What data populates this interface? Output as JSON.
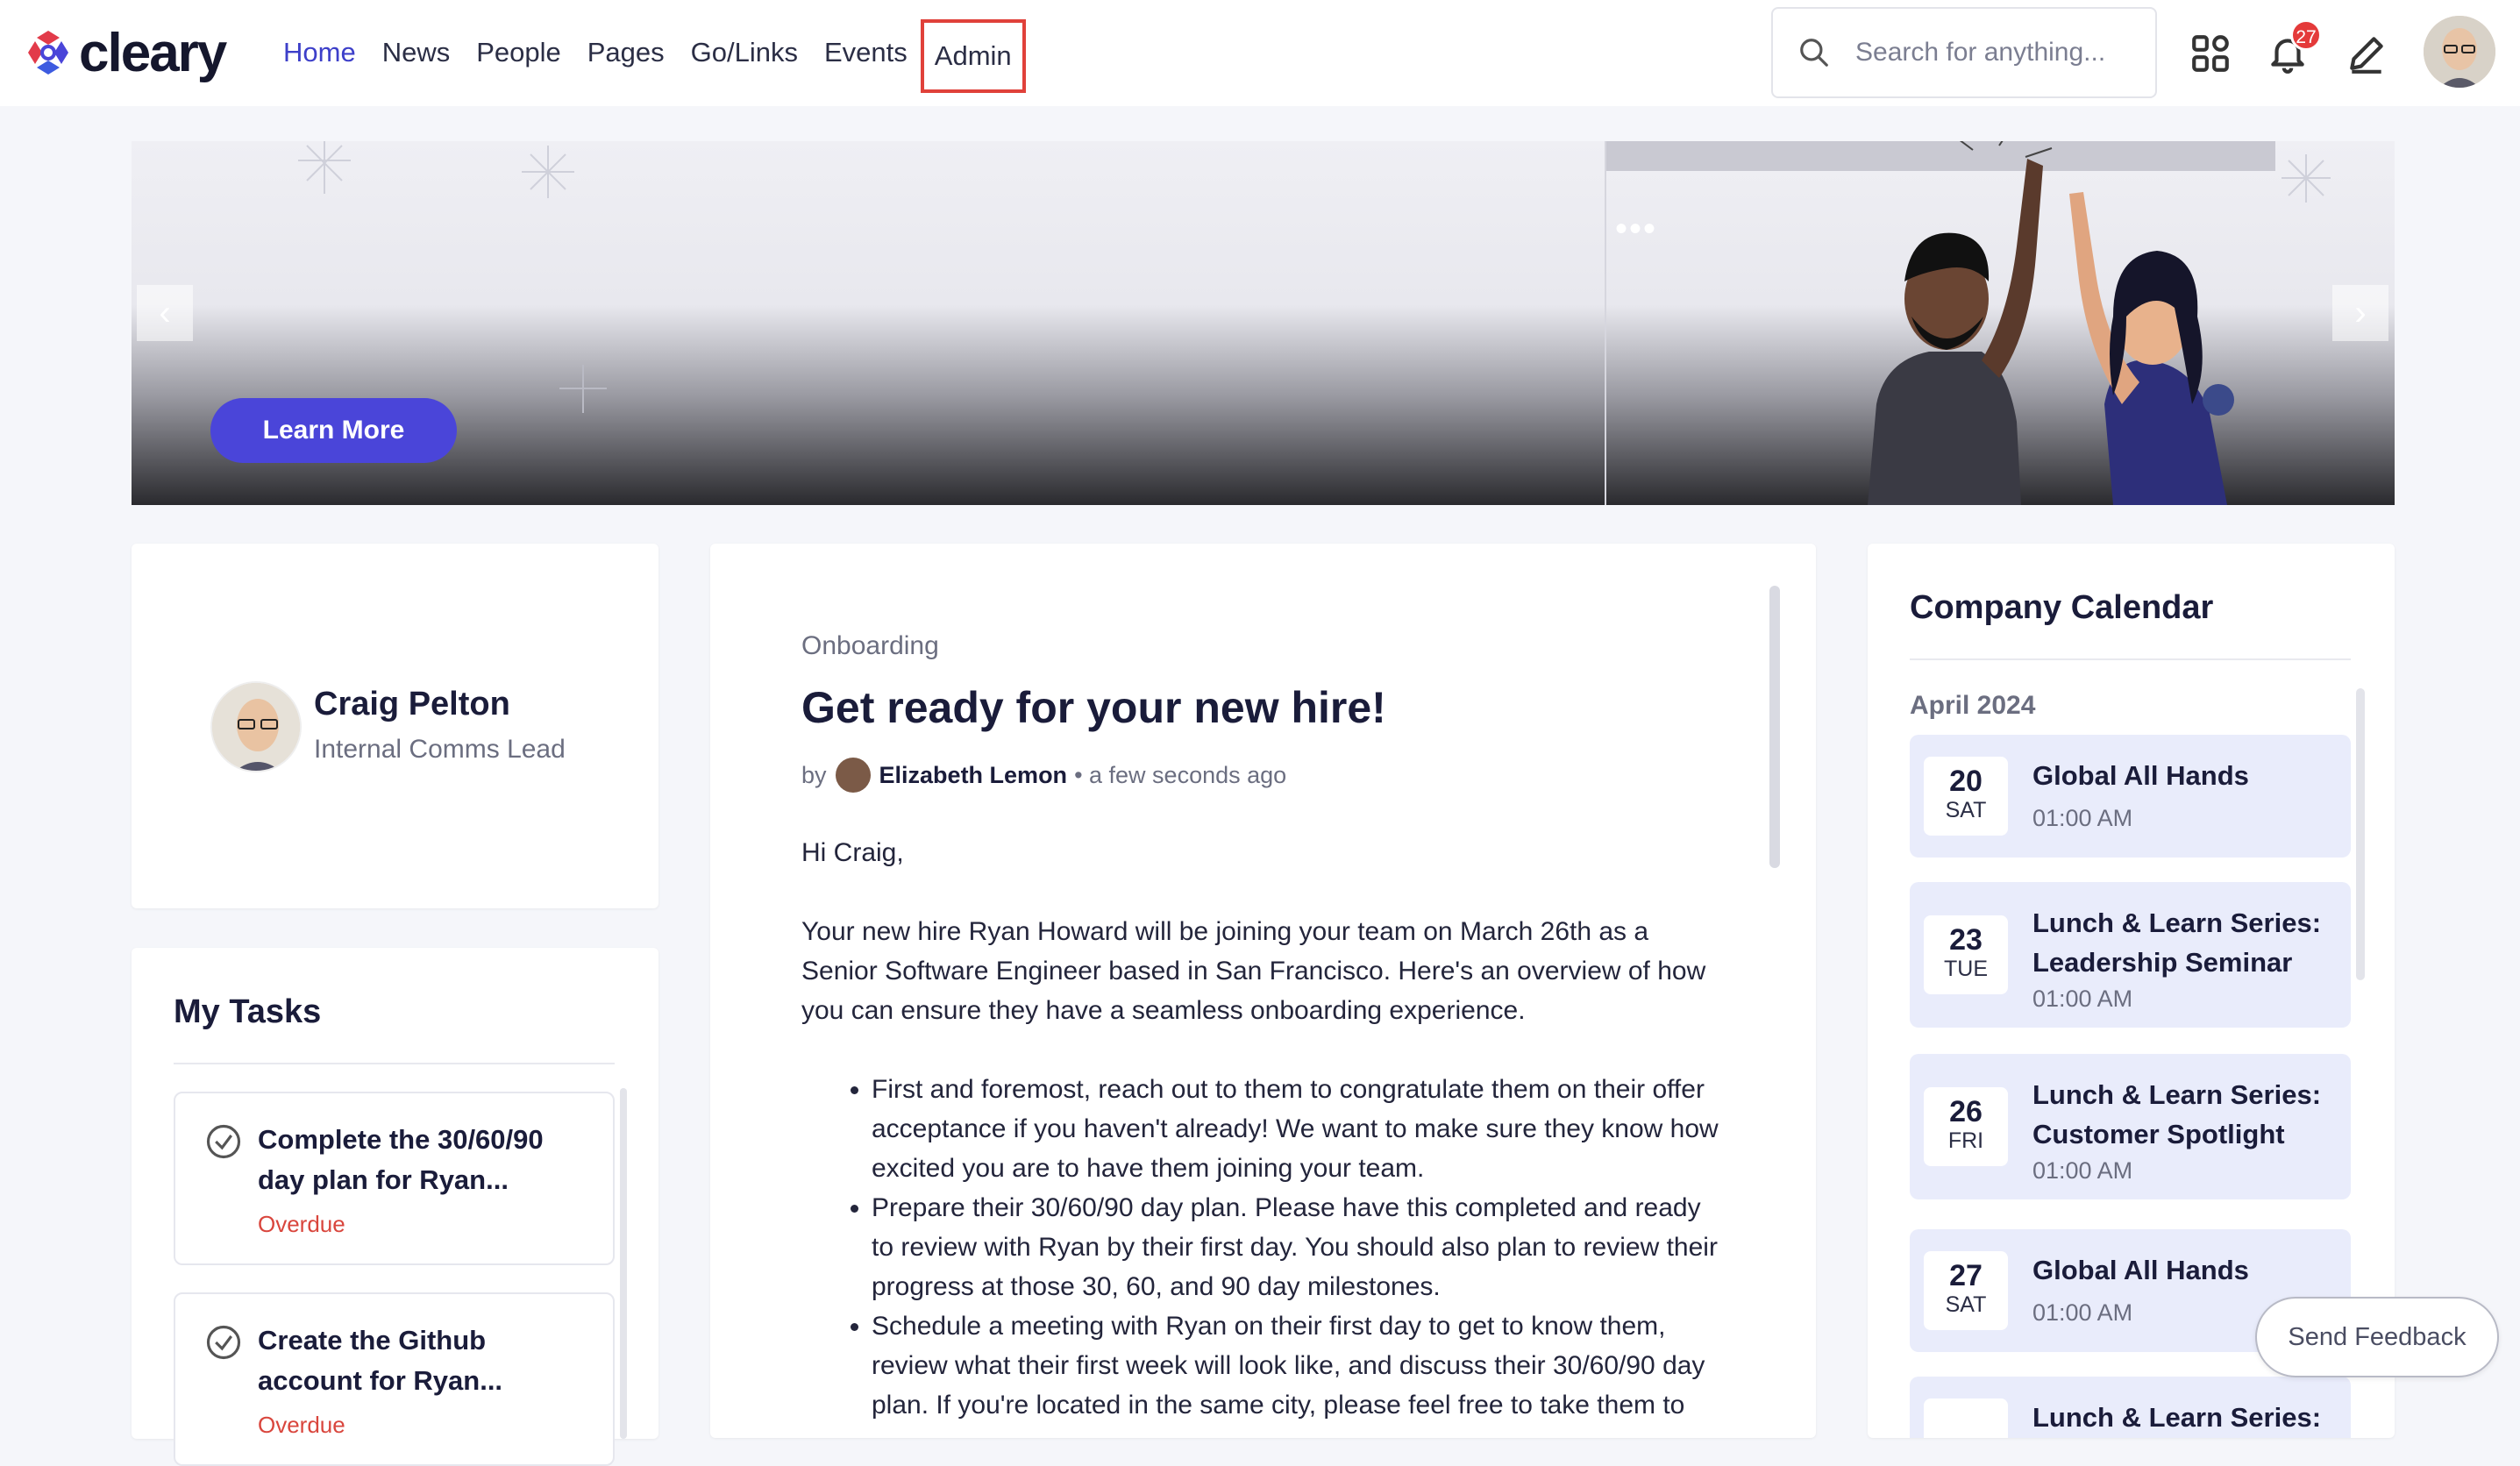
{
  "brand": {
    "name": "cleary",
    "accent": "#4a45d9"
  },
  "nav": {
    "items": [
      {
        "label": "Home",
        "active": true
      },
      {
        "label": "News"
      },
      {
        "label": "People"
      },
      {
        "label": "Pages"
      },
      {
        "label": "Go/Links"
      },
      {
        "label": "Events"
      },
      {
        "label": "Admin",
        "highlighted": true
      }
    ]
  },
  "search": {
    "placeholder": "Search for anything..."
  },
  "notifications": {
    "count": "27"
  },
  "banner": {
    "cta_label": "Learn More"
  },
  "profile": {
    "name": "Craig Pelton",
    "role": "Internal Comms Lead"
  },
  "tasks": {
    "title": "My Tasks",
    "items": [
      {
        "title": "Complete the 30/60/90 day plan for Ryan...",
        "status": "Overdue"
      },
      {
        "title": "Create the Github account for Ryan...",
        "status": "Overdue"
      }
    ]
  },
  "article": {
    "category": "Onboarding",
    "title": "Get ready for your new hire!",
    "by": "by",
    "author": "Elizabeth Lemon",
    "time": "• a few seconds ago",
    "greeting": "Hi Craig,",
    "intro": "Your new hire Ryan Howard will be joining your team on March 26th as a Senior Software Engineer based in San Francisco. Here's an overview of how you can ensure they have a seamless onboarding experience.",
    "bullets": [
      "First and foremost, reach out to them to congratulate them on their offer acceptance if you haven't already! We want to make sure they know how excited you are to have them joining your team.",
      "Prepare their 30/60/90 day plan. Please have this completed and ready to review with Ryan by their first day. You should also plan to review their progress at those 30, 60, and 90 day milestones.",
      "Schedule a meeting with Ryan on their first day to get to know them, review what their first week will look like, and discuss their 30/60/90 day plan. If you're located in the same city, please feel free to take them to"
    ]
  },
  "calendar": {
    "title": "Company Calendar",
    "month": "April 2024",
    "events": [
      {
        "day": "20",
        "dow": "SAT",
        "name": "Global All Hands",
        "time": "01:00 AM"
      },
      {
        "day": "23",
        "dow": "TUE",
        "name": "Lunch & Learn Series: Leadership Seminar",
        "time": "01:00 AM"
      },
      {
        "day": "26",
        "dow": "FRI",
        "name": "Lunch & Learn Series: Customer Spotlight",
        "time": "01:00 AM"
      },
      {
        "day": "27",
        "dow": "SAT",
        "name": "Global All Hands",
        "time": "01:00 AM"
      },
      {
        "day": "",
        "dow": "",
        "name": "Lunch & Learn Series:",
        "time": ""
      }
    ]
  },
  "feedback": {
    "label": "Send Feedback"
  }
}
